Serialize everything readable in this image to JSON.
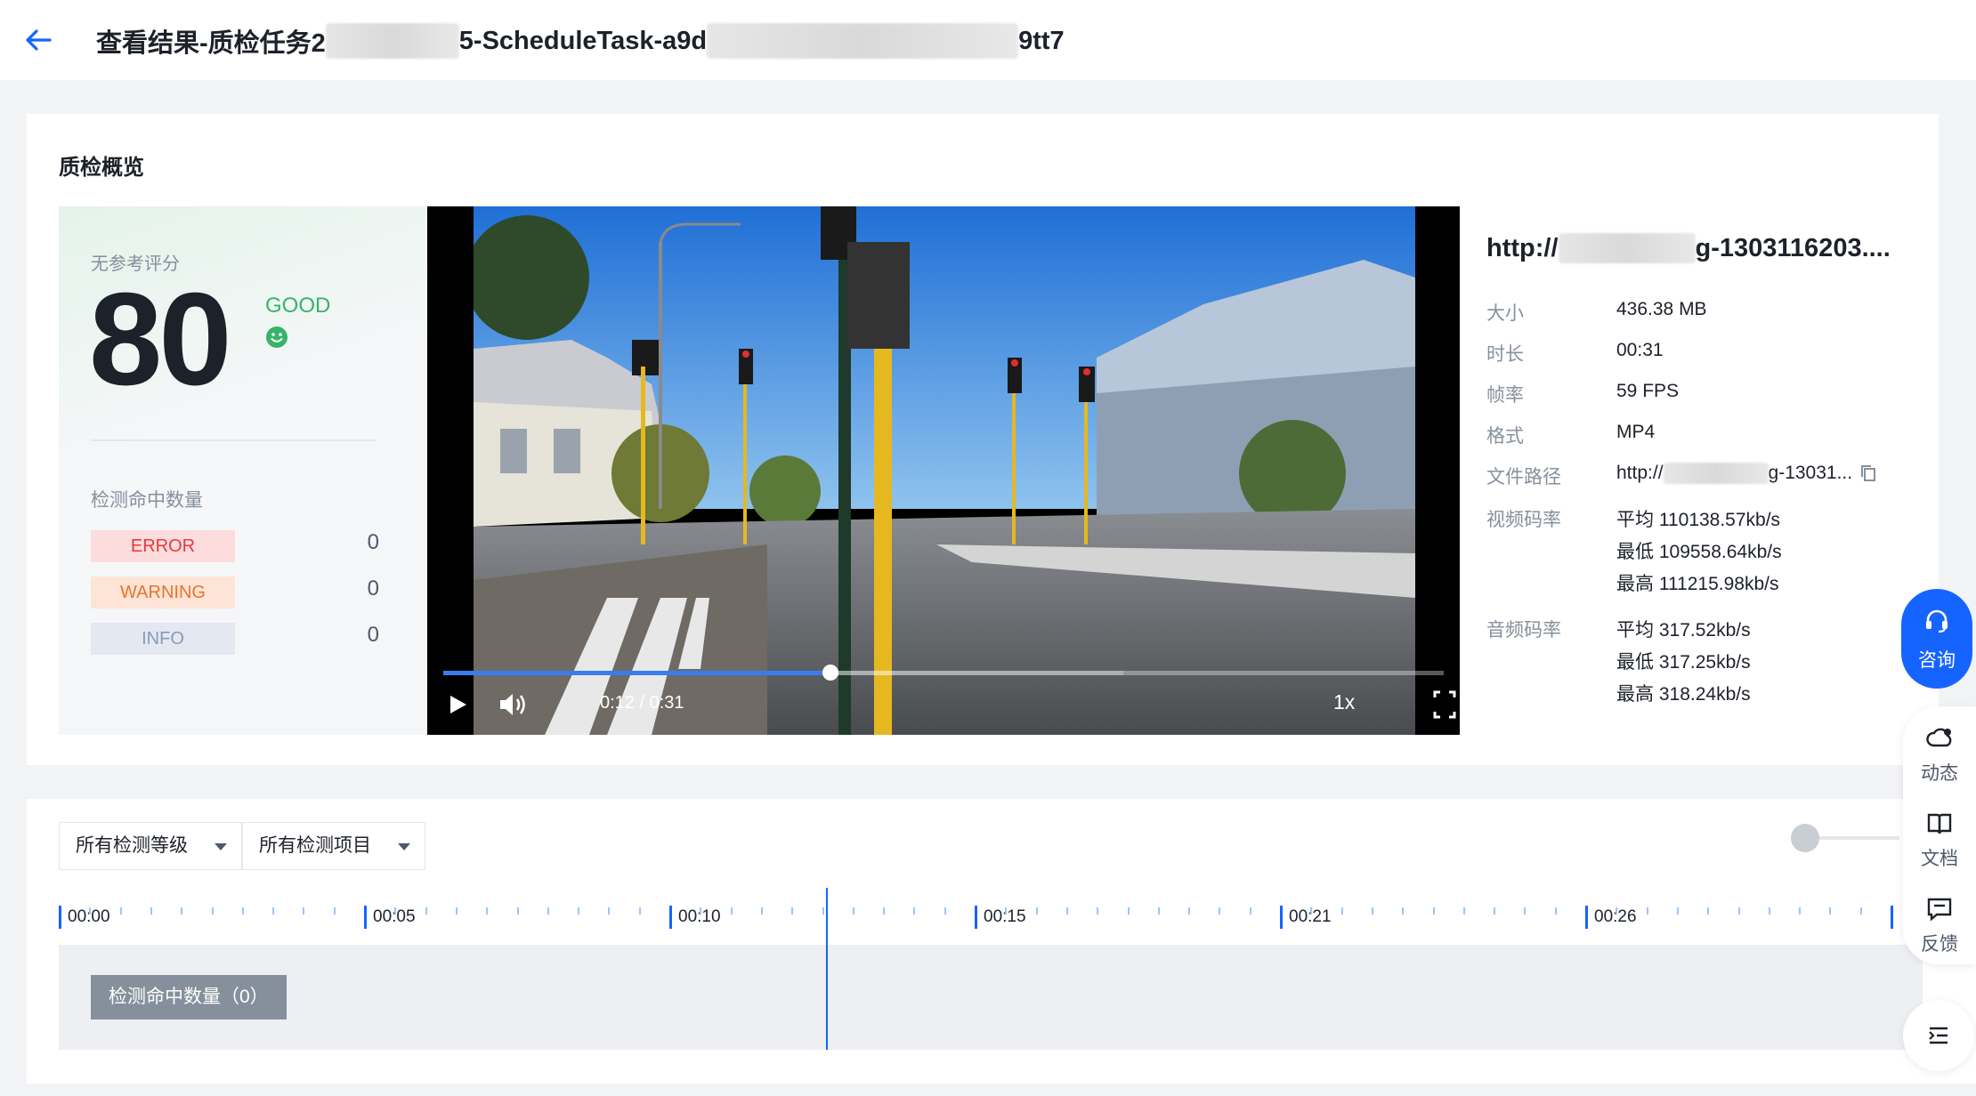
{
  "header": {
    "title_part1": "查看结果-质检任务2",
    "title_part2": "5-ScheduleTask-a9d",
    "title_part3": "9tt7"
  },
  "overview": {
    "title": "质检概览",
    "score_label": "无参考评分",
    "score": "80",
    "grade": "GOOD",
    "hit_label": "检测命中数量",
    "levels": [
      {
        "label": "ERROR",
        "count": "0",
        "bg": "#fcdcdc",
        "color": "#e8383d"
      },
      {
        "label": "WARNING",
        "count": "0",
        "bg": "#fde4d6",
        "color": "#e8742e"
      },
      {
        "label": "INFO",
        "count": "0",
        "bg": "#e4e8f1",
        "color": "#8a9ab8"
      }
    ]
  },
  "player": {
    "time": "0:12 / 0:31",
    "speed": "1x",
    "progress_fraction": 0.387,
    "buffered_fraction": 0.68
  },
  "file": {
    "url_start": "http://",
    "url_end": "g-1303116203....",
    "rows": [
      {
        "key": "大小",
        "value": "436.38 MB"
      },
      {
        "key": "时长",
        "value": "00:31"
      },
      {
        "key": "帧率",
        "value": "59 FPS"
      },
      {
        "key": "格式",
        "value": "MP4"
      }
    ],
    "path_key": "文件路径",
    "path_start": "http://",
    "path_end": "g-13031...",
    "vbitrate_key": "视频码率",
    "vbitrate": [
      "平均 110138.57kb/s",
      "最低 109558.64kb/s",
      "最高 111215.98kb/s"
    ],
    "abitrate_key": "音频码率",
    "abitrate": [
      "平均 317.52kb/s",
      "最低 317.25kb/s",
      "最高 318.24kb/s"
    ]
  },
  "filters": {
    "level": "所有检测等级",
    "item": "所有检测项目"
  },
  "timeline": {
    "ticks": [
      "00:00",
      "00:05",
      "00:10",
      "00:15",
      "00:21",
      "00:26"
    ],
    "track_label": "检测命中数量（0）"
  },
  "side": {
    "consult": "咨询",
    "news": "动态",
    "docs": "文档",
    "feedback": "反馈"
  },
  "colors": {
    "accent": "#1664ff",
    "good": "#37b36a"
  }
}
